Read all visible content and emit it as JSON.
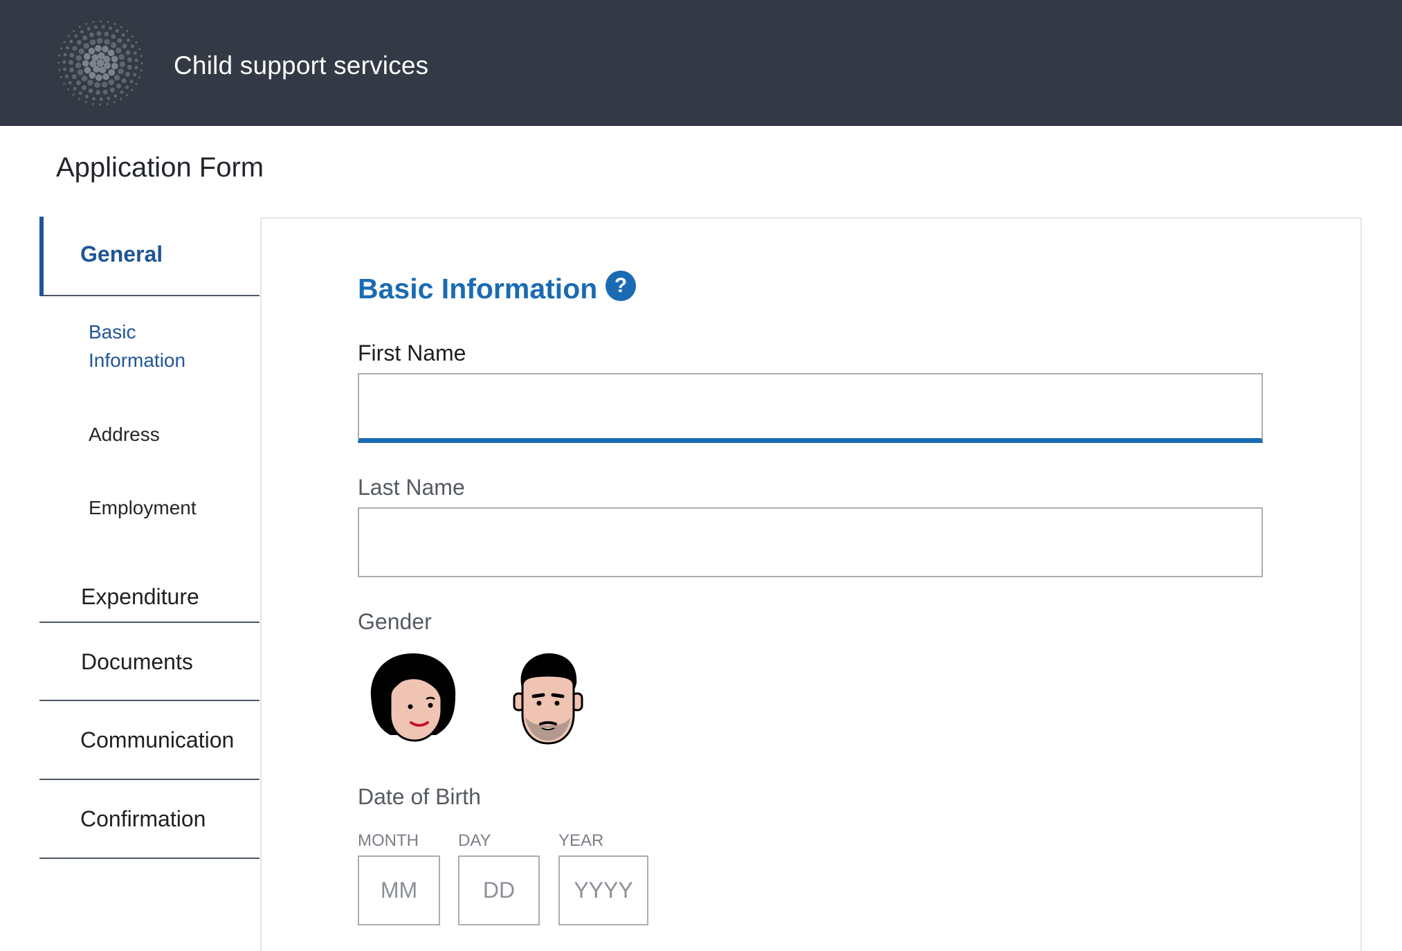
{
  "header": {
    "app_title": "Child support services",
    "logo_icon": "dotted-circle-logo"
  },
  "page": {
    "title": "Application Form"
  },
  "sidebar": {
    "sections": [
      {
        "label": "General",
        "active": true
      },
      {
        "label": "Expenditure"
      },
      {
        "label": "Documents"
      },
      {
        "label": "Communication"
      },
      {
        "label": "Confirmation"
      }
    ],
    "general_items": [
      {
        "label_line1": "Basic",
        "label_line2": "Information",
        "active": true
      },
      {
        "label": "Address"
      },
      {
        "label": "Employment"
      }
    ]
  },
  "form": {
    "section_title": "Basic Information",
    "help_icon": "question-mark-icon",
    "help_glyph": "?",
    "first_name": {
      "label": "First Name",
      "value": "",
      "focused": true
    },
    "last_name": {
      "label": "Last Name",
      "value": ""
    },
    "gender": {
      "label": "Gender",
      "options": [
        "female-avatar-icon",
        "male-avatar-icon"
      ]
    },
    "dob": {
      "label": "Date of Birth",
      "month_label": "MONTH",
      "day_label": "DAY",
      "year_label": "YEAR",
      "month_placeholder": "MM",
      "day_placeholder": "DD",
      "year_placeholder": "YYYY"
    }
  },
  "colors": {
    "header_bg": "#343a45",
    "accent": "#1a6bb3",
    "nav_active": "#1f5599"
  }
}
